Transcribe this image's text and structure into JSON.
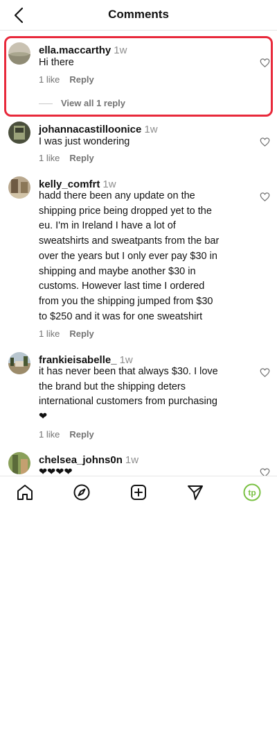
{
  "header": {
    "title": "Comments"
  },
  "comments": [
    {
      "username": "ella.maccarthy",
      "time": "1w",
      "text": "Hi there",
      "likes": "1 like",
      "reply": "Reply",
      "view_replies": "View all 1 reply"
    },
    {
      "username": "johannacastilloonice",
      "time": "1w",
      "text": "I was just wondering",
      "likes": "1 like",
      "reply": "Reply"
    },
    {
      "username": "kelly_comfrt",
      "time": "1w",
      "lines": [
        "hadd there been any update on the",
        "shipping price being dropped yet to the",
        "eu. I'm in Ireland I have a lot of",
        "sweatshirts and sweatpants from the bar",
        "over the years but I only ever pay $30 in",
        "shipping and maybe another $30 in",
        "customs. However last time I ordered",
        "from you the shipping jumped from $30",
        "to $250 and it was for one sweatshirt"
      ],
      "likes": "1 like",
      "reply": "Reply"
    },
    {
      "username": "frankieisabelle_",
      "time": "1w",
      "lines": [
        "it has never been that always $30. I love",
        "the brand but the shipping deters",
        "international customers from purchasing",
        "❤"
      ],
      "likes": "1 like",
      "reply": "Reply"
    },
    {
      "username": "chelsea_johns0n",
      "time": "1w",
      "text": "❤❤❤❤"
    }
  ],
  "nav": {
    "items": [
      "home-icon",
      "explore-icon",
      "create-icon",
      "direct-icon",
      "profile-icon"
    ],
    "profile_initials": "tp"
  },
  "colors": {
    "highlight": "#e8293b",
    "profile_accent": "#7ac143"
  }
}
